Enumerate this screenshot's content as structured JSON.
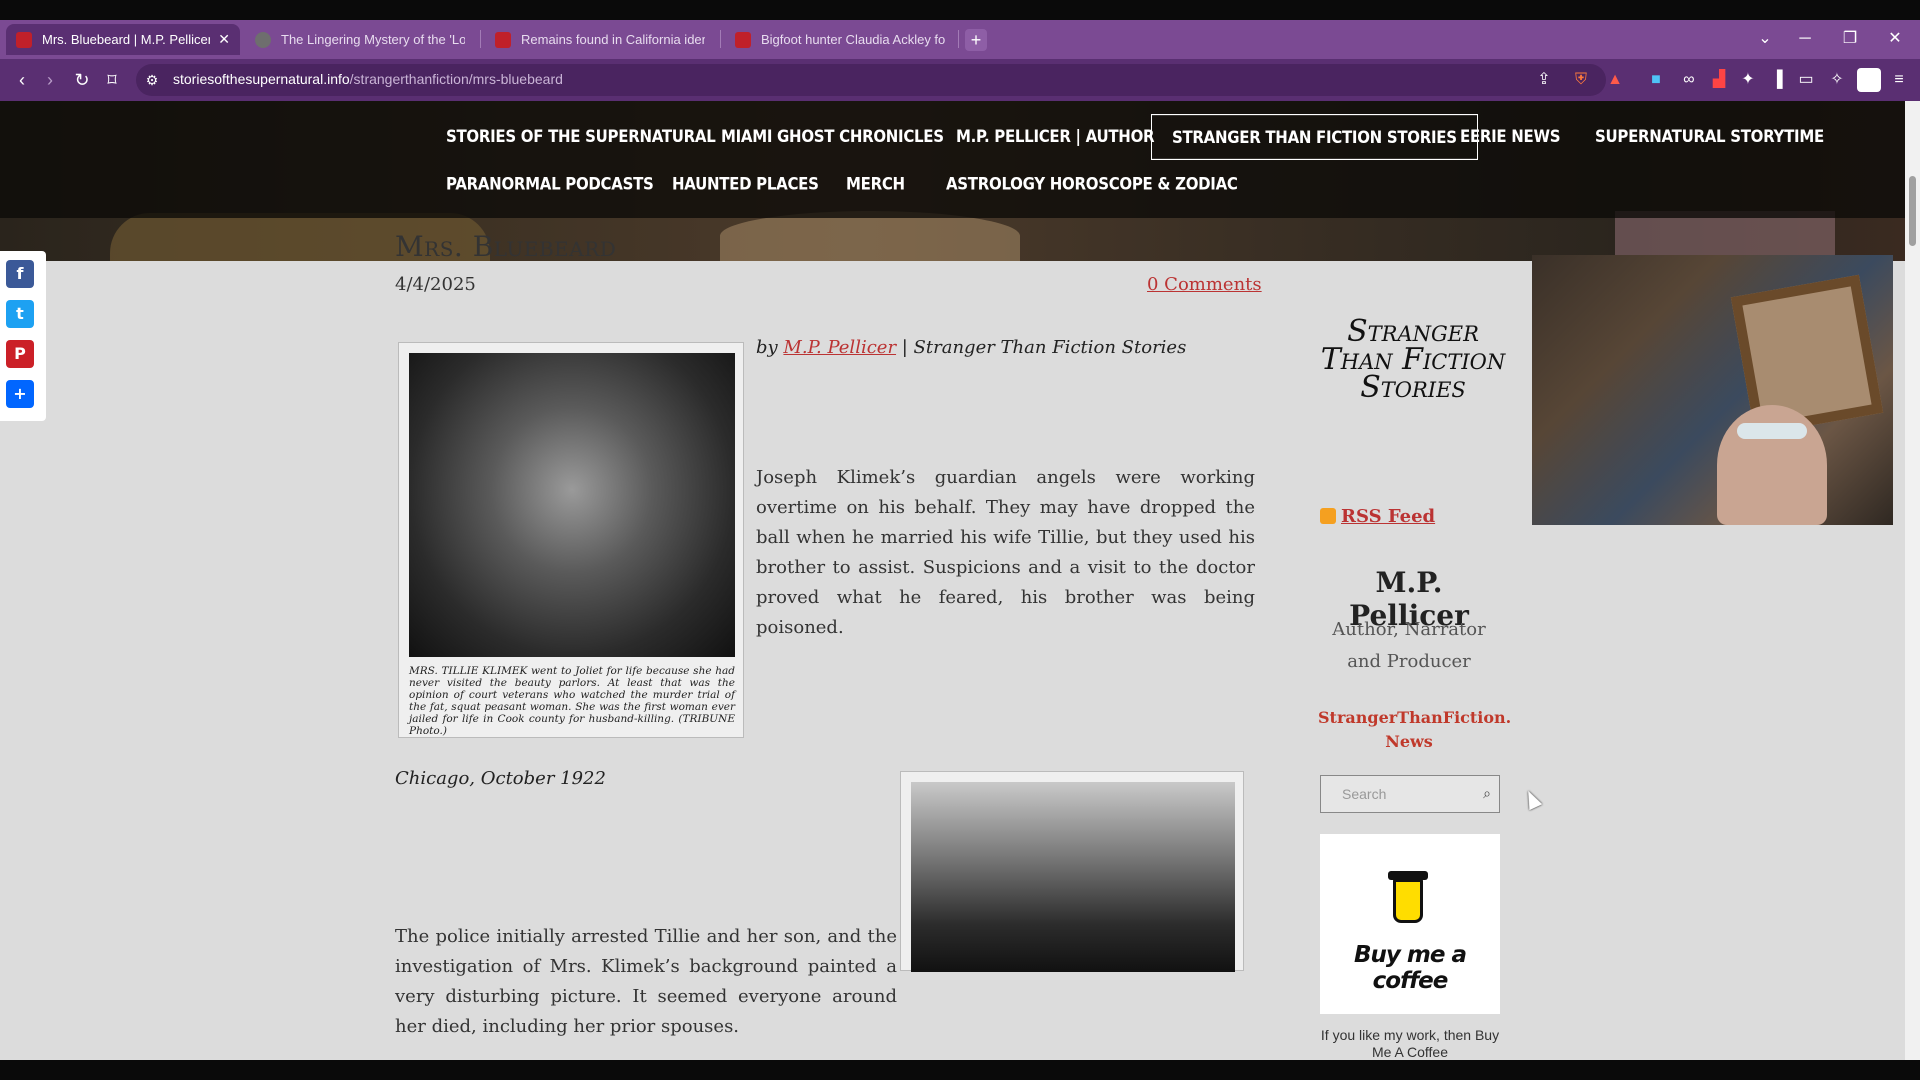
{
  "browser": {
    "tabs": [
      {
        "title": "Mrs. Bluebeard | M.P. Pellicer",
        "active": true
      },
      {
        "title": "The Lingering Mystery of the 'Lost C",
        "active": false
      },
      {
        "title": "Remains found in California identifie",
        "active": false
      },
      {
        "title": "Bigfoot hunter Claudia Ackley foun",
        "active": false
      }
    ],
    "new_tab": "+",
    "close_tab": "✕",
    "tab_list": "⌄",
    "minimize": "─",
    "restore": "❐",
    "close": "✕",
    "url_host": "storiesofthesupernatural.info",
    "url_path": "/strangerthanfiction/mrs-bluebeard",
    "accent": "#7b4a93"
  },
  "nav": {
    "row1": [
      "Stories of the Supernatural",
      "Miami Ghost Chronicles",
      "M.P. Pellicer | Author",
      "Stranger Than Fiction Stories",
      "Eerie News",
      "Supernatural Storytime"
    ],
    "row2": [
      "Paranormal Podcasts",
      "Haunted Places",
      "Merch",
      "Astrology Horoscope & Zodiac"
    ],
    "selected": "Stranger Than Fiction Stories"
  },
  "social": [
    "f",
    "t",
    "P",
    "+"
  ],
  "article": {
    "title": "Mrs. Bluebeard",
    "date": "4/4/2025",
    "comments": "0 Comments",
    "byline_prefix": "by ",
    "author_link": "M.P. Pellicer",
    "byline_suffix": " | Stranger Than Fiction Stories",
    "intro": "Joseph Klimek’s guardian angels were working overtime on his behalf. They may have dropped the ball when he married his wife Tillie, but they used his brother to assist. Suspicions and a visit to the doctor proved what he feared, his brother was being poisoned.",
    "photo1_caption": "MRS. TILLIE KLIMEK went to Joliet for life because she had never visited the beauty parlors. At least that was the opinion of court veterans who watched the murder trial of the fat, squat peasant woman. She was the first woman ever jailed for life in Cook county for husband-killing. (TRIBUNE Photo.)",
    "location": "Chicago, October 1922",
    "para2": "The police initially arrested Tillie and her son, and the investigation of Mrs. Klimek’s background painted a very disturbing picture. It seemed everyone around her died, including her prior spouses."
  },
  "sidebar": {
    "logo_text": "Stranger Than Fiction Stories",
    "rss": "RSS Feed",
    "author_name": "M.P. Pellicer",
    "author_role": "Author, Narrator and Producer",
    "site_link": "StrangerThanFiction. News",
    "search_placeholder": "Search",
    "bmc_text": "Buy me a coffee",
    "bmc_note": "If you like my work, then Buy Me A Coffee"
  }
}
